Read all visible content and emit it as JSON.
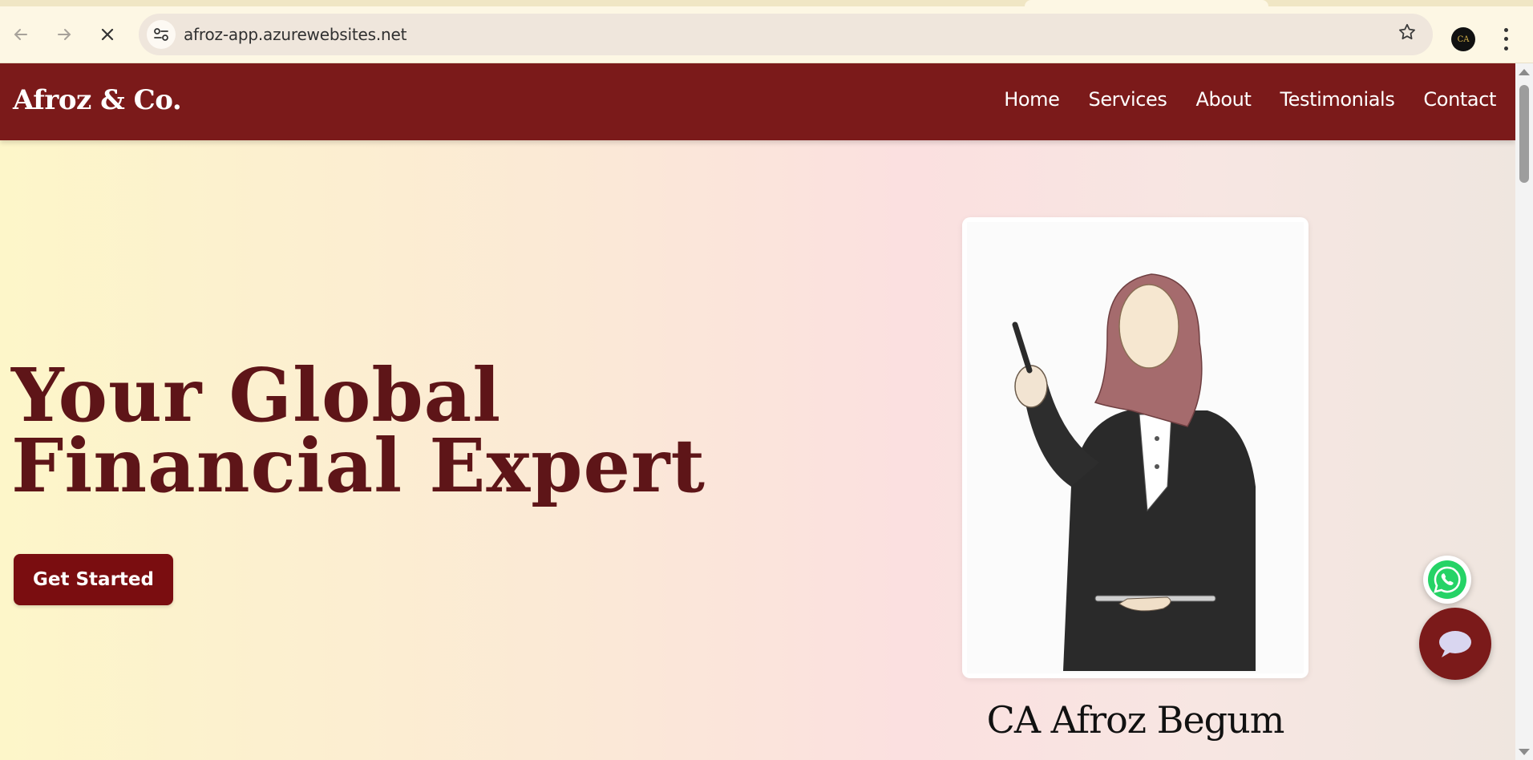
{
  "browser": {
    "url": "afroz-app.azurewebsites.net",
    "profile_initials": "CA",
    "icons": {
      "back": "arrow-left-icon",
      "forward": "arrow-right-icon",
      "stop": "close-icon",
      "site_info": "tune-icon",
      "bookmark": "star-icon",
      "menu": "kebab-menu-icon"
    }
  },
  "site": {
    "brand": "Afroz & Co.",
    "nav": [
      "Home",
      "Services",
      "About",
      "Testimonials",
      "Contact"
    ],
    "hero": {
      "title_line1": "Your Global",
      "title_line2": "Financial Expert",
      "cta": "Get Started"
    },
    "profile_name": "CA Afroz Begum",
    "widgets": {
      "whatsapp": "whatsapp-icon",
      "chat": "chat-bubble-icon"
    }
  },
  "colors": {
    "brand_maroon": "#7b1a1a",
    "hero_title": "#5e1518",
    "cta_bg": "#7a0d10",
    "whatsapp_green": "#25d366"
  }
}
